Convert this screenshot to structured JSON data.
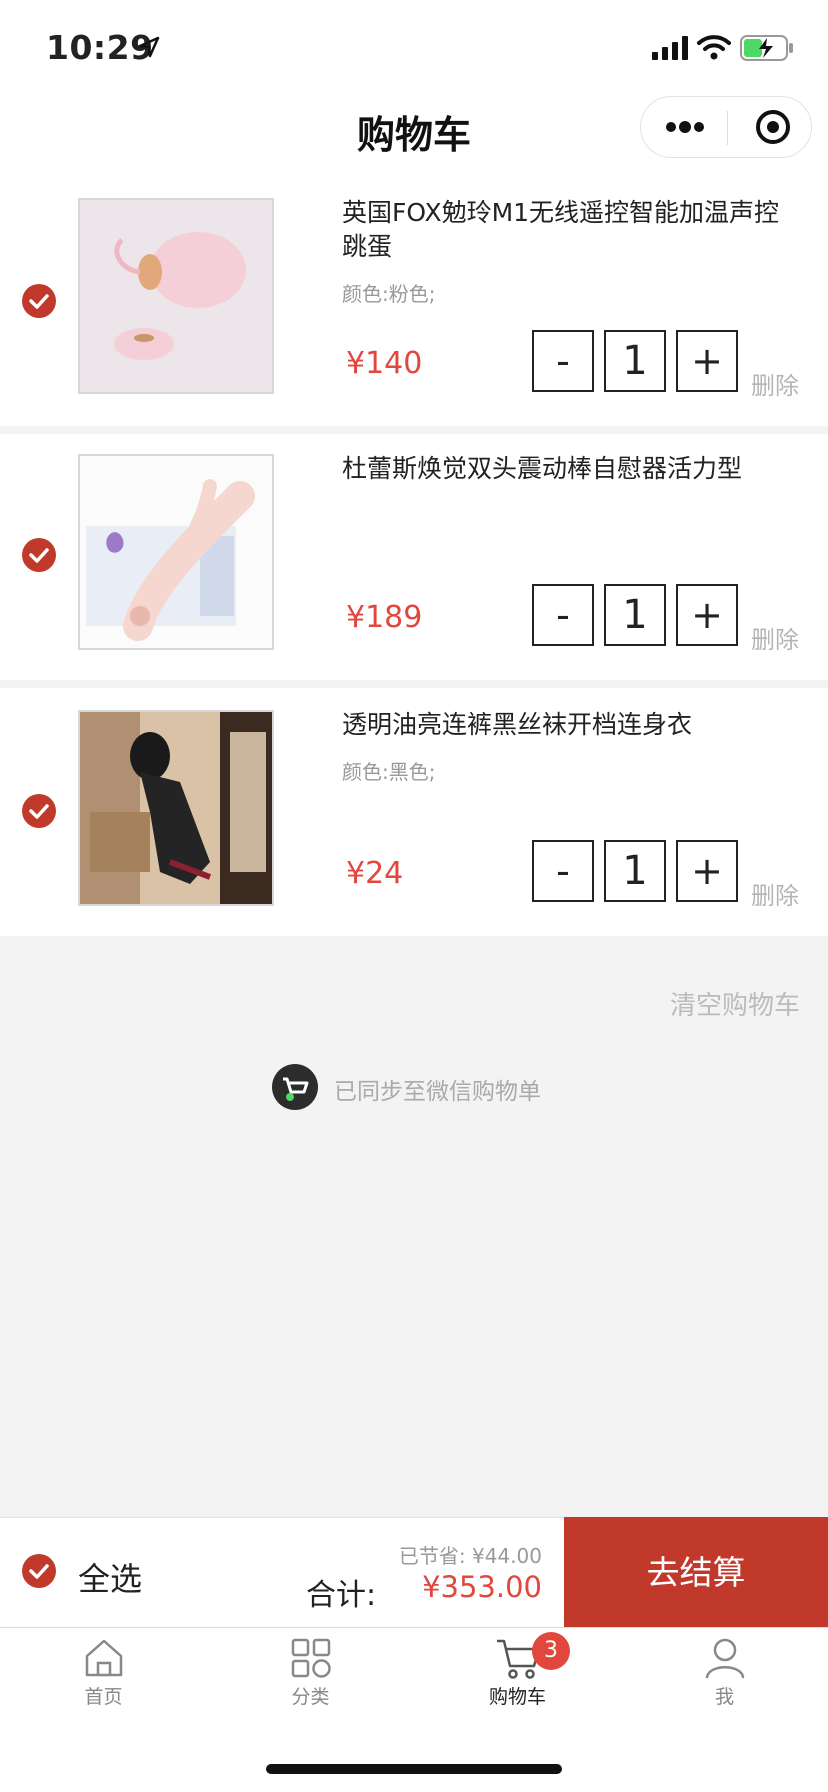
{
  "status_bar": {
    "time": "10:29"
  },
  "nav": {
    "title": "购物车"
  },
  "items": [
    {
      "title": "英国FOX勉玲M1无线遥控智能加温声控跳蛋",
      "attr": "颜色:粉色;",
      "price": "¥140",
      "qty": "1",
      "delete_label": "删除"
    },
    {
      "title": "杜蕾斯焕觉双头震动棒自慰器活力型",
      "attr": "",
      "price": "¥189",
      "qty": "1",
      "delete_label": "删除"
    },
    {
      "title": "透明油亮连裤黑丝袜开档连身衣",
      "attr": "颜色:黑色;",
      "price": "¥24",
      "qty": "1",
      "delete_label": "删除"
    }
  ],
  "qty_controls": {
    "minus": "-",
    "plus": "+"
  },
  "clear_cart_label": "清空购物车",
  "sync_text": "已同步至微信购物单",
  "checkout": {
    "select_all_label": "全选",
    "saved_text": "已节省: ¥44.00",
    "total_label": "合计:",
    "total_value": "¥353.00",
    "button_label": "去结算"
  },
  "tabs": [
    {
      "label": "首页",
      "icon": "home-icon"
    },
    {
      "label": "分类",
      "icon": "category-icon"
    },
    {
      "label": "购物车",
      "icon": "cart-icon",
      "badge": "3",
      "active": true
    },
    {
      "label": "我",
      "icon": "user-icon"
    }
  ],
  "colors": {
    "accent": "#c0392b",
    "price": "#e2473e",
    "background": "#f3f3f3"
  }
}
